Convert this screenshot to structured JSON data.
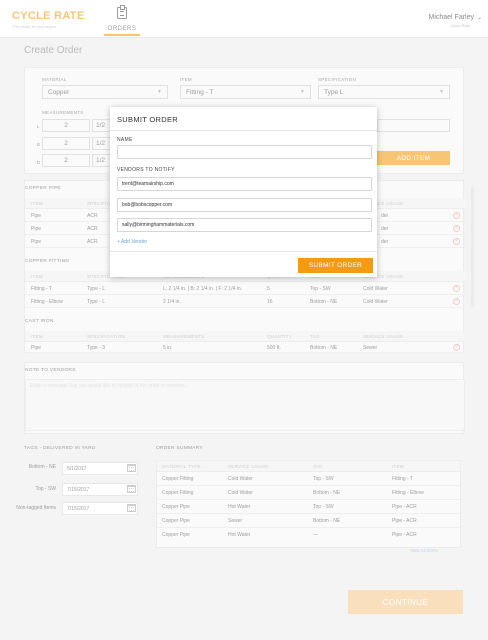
{
  "header": {
    "brand": "CYCLE RATE",
    "tagline": "The rewild for you region",
    "nav_orders": "ORDERS",
    "user_name": "Michael Farley",
    "user_caret": "⌄",
    "user_location": "Cycle Rate"
  },
  "page_title": "Create Order",
  "form": {
    "material_label": "MATERIAL",
    "material_value": "Copper",
    "item_label": "ITEM",
    "item_value": "Fitting - T",
    "spec_label": "SPECIFICATION",
    "spec_value": "Type L",
    "measurements_label": "MEASUREMENTS",
    "rows": [
      {
        "dim": "L",
        "whole": "2",
        "frac": "1/2"
      },
      {
        "dim": "B",
        "whole": "2",
        "frac": "1/2"
      },
      {
        "dim": "D",
        "whole": "2",
        "frac": "1/2"
      }
    ],
    "add_item": "ADD ITEM"
  },
  "tables": {
    "headers": [
      "ITEM",
      "SPECIFICATION",
      "MEASUREMENTS",
      "QUANTITY",
      "TAG",
      "SERVICE USAGE"
    ],
    "copper_pipe": {
      "title": "COPPER PIPE",
      "rows": [
        {
          "item": "Pipe",
          "spec": "ACR",
          "usage": "der"
        },
        {
          "item": "Pipe",
          "spec": "ACR",
          "usage": "der"
        },
        {
          "item": "Pipe",
          "spec": "ACR",
          "usage": "der"
        }
      ]
    },
    "copper_fitting": {
      "title": "COPPER FITTING",
      "rows": [
        {
          "item": "Fitting - T",
          "spec": "Type - L",
          "meas": "L: 2 1/4 in. | B: 2 1/4 in. | F: 2 1/4 in.",
          "qty": "5",
          "tag": "Top - SW",
          "usage": "Cold Water"
        },
        {
          "item": "Fitting - Elbow",
          "spec": "Type - L",
          "meas": "2 1/4 in.",
          "qty": "16",
          "tag": "Bottom - NE",
          "usage": "Cold Water"
        }
      ]
    },
    "cast_iron": {
      "title": "CAST IRON",
      "rows": [
        {
          "item": "Pipe",
          "spec": "Type - 3",
          "meas": "5 in.",
          "qty": "500 ft.",
          "tag": "Bottom - NE",
          "usage": "Sewer"
        }
      ]
    }
  },
  "note": {
    "title": "NOTE TO VENDORS",
    "placeholder": "Enter a message that you would like to include in the order to vendors..."
  },
  "tags": {
    "title": "TAGS - DELIVERED IN YARD",
    "items": [
      {
        "label": "Bottom - NE",
        "date": "5/1/2017"
      },
      {
        "label": "Top - SW",
        "date": "7/15/2017"
      },
      {
        "label": "Non-tagged Items",
        "date": "7/15/2017"
      }
    ]
  },
  "summary": {
    "title": "ORDER SUMMARY",
    "headers": [
      "MATERIAL TYPE",
      "SERVICE USAGE",
      "TAG",
      "ITEM"
    ],
    "rows": [
      [
        "Copper Fitting",
        "Cold Water",
        "Top - SW",
        "Fitting - T"
      ],
      [
        "Copper Fitting",
        "Cold Water",
        "Bottom - NE",
        "Fitting - Elbow"
      ],
      [
        "Copper Pipe",
        "Hot Water",
        "Top - SW",
        "Pipe - ACR"
      ],
      [
        "Copper Pipe",
        "Sewer",
        "Bottom - NE",
        "Pipe - ACR"
      ],
      [
        "Copper Pipe",
        "Hot Water",
        "—",
        "Pipe - ACR"
      ]
    ],
    "view_all": "View All Items"
  },
  "continue": "CONTINUE",
  "modal": {
    "title": "SUBMIT ORDER",
    "name_label": "NAME",
    "name_value": "",
    "vendors_label": "VENDORS TO NOTIFY",
    "vendors": [
      "trent@teamairship.com",
      "bob@bobscopper.com",
      "sally@birminghammaterials.com"
    ],
    "add_vendor": "+ Add Vendor",
    "submit": "SUBMIT ORDER"
  },
  "colors": {
    "accent": "#f39c12",
    "remove": "#e8a4a4"
  }
}
